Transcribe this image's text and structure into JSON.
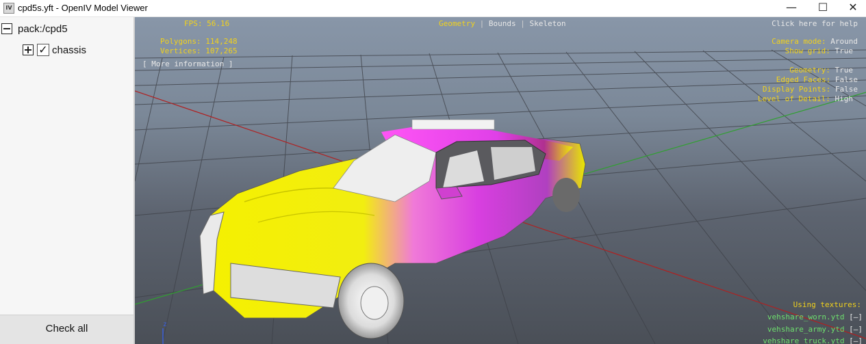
{
  "window": {
    "title": "cpd5s.yft - OpenIV Model Viewer",
    "app_icon": "IV",
    "minimize": "—",
    "maximize": "☐",
    "close": "✕"
  },
  "sidebar": {
    "root_label": "pack:/cpd5",
    "child_label": "chassis",
    "check_all": "Check all"
  },
  "hud": {
    "fps": "FPS: 56.16",
    "polygons": "Polygons: 114,248",
    "vertices": "Vertices: 107,265",
    "more_info": "[ More information ]",
    "tabs": [
      "Geometry",
      "Bounds",
      "Skeleton"
    ],
    "tab_sep": "|",
    "help": "Click here for help",
    "camera_label": "Camera mode:",
    "camera_value": "Around",
    "grid_label": "Show grid:",
    "grid_value": "True",
    "geometry_label": "Geometry:",
    "geometry_value": "True",
    "edged_label": "Edged Faces:",
    "edged_value": "False",
    "points_label": "Display Points:",
    "points_value": "False",
    "lod_label": "Level of Detail:",
    "lod_value": "High",
    "textures_label": "Using textures:",
    "textures": [
      {
        "name": "vehshare_worn.ytd",
        "btn": "[–]"
      },
      {
        "name": "vehshare_army.ytd",
        "btn": "[–]"
      },
      {
        "name": "vehshare_truck.ytd",
        "btn": "[–]"
      }
    ],
    "axis_z": "z"
  },
  "colors": {
    "hud_yellow": "#f2d21c",
    "hud_green": "#6ee06e",
    "car_yellow": "#f5f000",
    "car_magenta": "#e040e8"
  }
}
